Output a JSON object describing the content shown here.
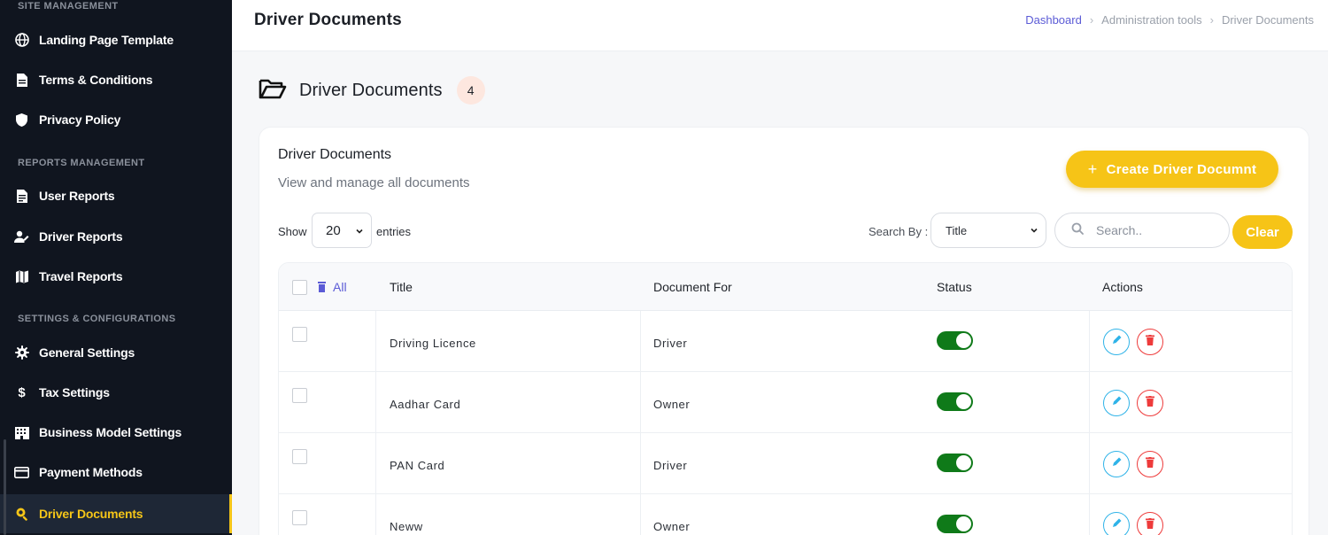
{
  "sidebar": {
    "sections": [
      {
        "title": "SITE MANAGEMENT"
      },
      {
        "title": "REPORTS MANAGEMENT"
      },
      {
        "title": "SETTINGS & CONFIGURATIONS"
      }
    ],
    "items": [
      {
        "label": "Landing Page Template",
        "icon": "globe-icon"
      },
      {
        "label": "Terms & Conditions",
        "icon": "document-icon"
      },
      {
        "label": "Privacy Policy",
        "icon": "shield-icon"
      },
      {
        "label": "User Reports",
        "icon": "report-icon"
      },
      {
        "label": "Driver Reports",
        "icon": "user-edit-icon"
      },
      {
        "label": "Travel Reports",
        "icon": "map-icon"
      },
      {
        "label": "General Settings",
        "icon": "gear-icon"
      },
      {
        "label": "Tax Settings",
        "icon": "dollar-icon"
      },
      {
        "label": "Business Model Settings",
        "icon": "building-icon"
      },
      {
        "label": "Payment Methods",
        "icon": "credit-card-icon"
      },
      {
        "label": "Driver Documents",
        "icon": "search-doc-icon",
        "active": true
      }
    ]
  },
  "header": {
    "title": "Driver Documents",
    "breadcrumb": [
      "Dashboard",
      "Administration tools",
      "Driver Documents"
    ]
  },
  "section": {
    "title": "Driver Documents",
    "count": "4"
  },
  "card": {
    "title": "Driver Documents",
    "subtitle": "View and manage all documents",
    "create_label": "Create Driver Documnt",
    "create_plus": "+",
    "show_label": "Show",
    "entries_value": "20",
    "entries_label": "entries",
    "search_by_label": "Search By :",
    "search_by_value": "Title",
    "search_placeholder": "Search..",
    "clear_label": "Clear"
  },
  "table": {
    "headers": {
      "all": "All",
      "title": "Title",
      "document_for": "Document For",
      "status": "Status",
      "actions": "Actions"
    },
    "rows": [
      {
        "title": "Driving Licence",
        "document_for": "Driver",
        "status": "on"
      },
      {
        "title": "Aadhar Card",
        "document_for": "Owner",
        "status": "on"
      },
      {
        "title": "PAN Card",
        "document_for": "Driver",
        "status": "on"
      },
      {
        "title": "Neww",
        "document_for": "Owner",
        "status": "on"
      }
    ]
  },
  "colors": {
    "accent": "#f6c417",
    "sidebar_bg": "#10151f",
    "toggle_on": "#0f7a19",
    "edit": "#2fb3e8",
    "delete": "#ee3b3b",
    "link": "#5b5bd6"
  }
}
